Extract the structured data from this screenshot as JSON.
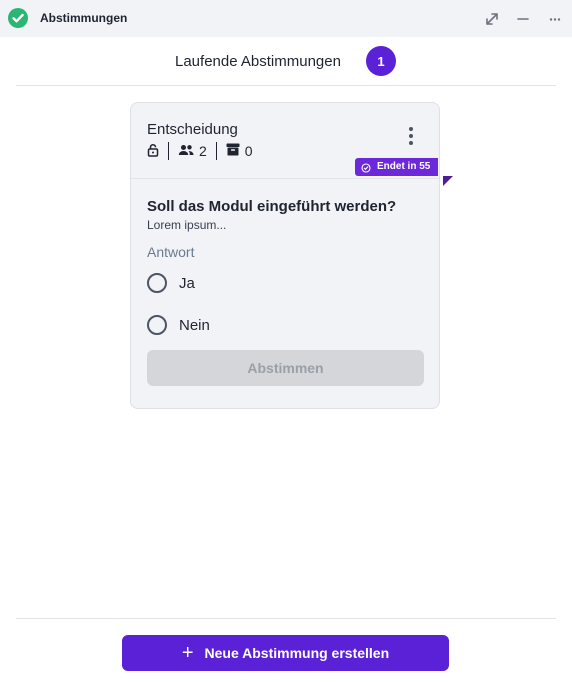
{
  "window": {
    "title": "Abstimmungen",
    "icons": [
      "check-circle-icon",
      "expand-icon",
      "minimize-icon",
      "more-horizontal-icon"
    ]
  },
  "header": {
    "title": "Laufende Abstimmungen",
    "count": "1"
  },
  "poll": {
    "title": "Entscheidung",
    "participants": "2",
    "archived": "0",
    "ends_badge": "Endet in 55",
    "question": "Soll das Modul eingeführt werden?",
    "description": "Lorem ipsum...",
    "answer_label": "Antwort",
    "options": [
      {
        "label": "Ja",
        "selected": false
      },
      {
        "label": "Nein",
        "selected": false
      }
    ],
    "vote_button": "Abstimmen"
  },
  "footer": {
    "create_button": "Neue Abstimmung erstellen"
  },
  "colors": {
    "accent": "#5b21d6",
    "badge": "#6d28d9",
    "app_icon": "#2bb673",
    "card_bg": "#f1f3f6"
  }
}
